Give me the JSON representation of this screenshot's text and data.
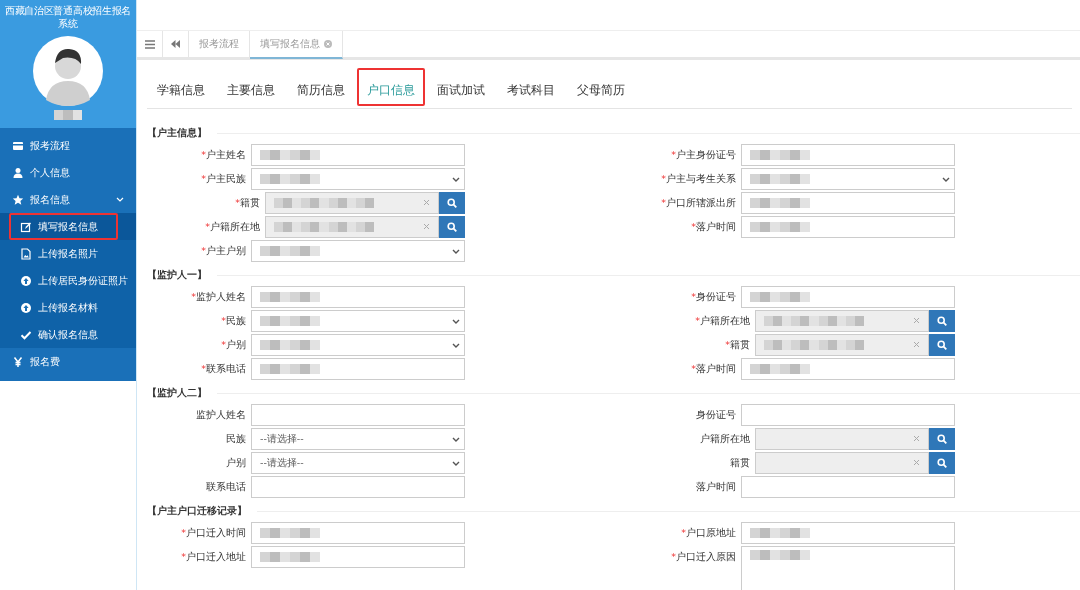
{
  "sidebar": {
    "title": "西藏自治区普通高校招生报名系统",
    "user": {
      "name_redacted": true
    },
    "menu": [
      {
        "label": "报考流程"
      },
      {
        "label": "个人信息"
      },
      {
        "label": "报名信息",
        "expanded": true,
        "children": [
          {
            "label": "填写报名信息",
            "selected": true,
            "highlighted": true
          },
          {
            "label": "上传报名照片",
            "selected": false,
            "highlighted": false
          },
          {
            "label": "上传居民身份证照片",
            "selected": false,
            "highlighted": false
          },
          {
            "label": "上传报名材料",
            "selected": false,
            "highlighted": false
          },
          {
            "label": "确认报名信息",
            "selected": false,
            "highlighted": false
          }
        ]
      },
      {
        "label": "报名费"
      }
    ]
  },
  "page_tabs": [
    {
      "label": "报考流程",
      "selected": false,
      "closable": false
    },
    {
      "label": "填写报名信息",
      "selected": true,
      "closable": true
    }
  ],
  "form_tabs": [
    {
      "label": "学籍信息",
      "selected": false,
      "highlighted": false
    },
    {
      "label": "主要信息",
      "selected": false,
      "highlighted": false
    },
    {
      "label": "简历信息",
      "selected": false,
      "highlighted": false
    },
    {
      "label": "户口信息",
      "selected": true,
      "highlighted": true
    },
    {
      "label": "面试加试",
      "selected": false,
      "highlighted": false
    },
    {
      "label": "考试科目",
      "selected": false,
      "highlighted": false
    },
    {
      "label": "父母简历",
      "selected": false,
      "highlighted": false
    }
  ],
  "sections": [
    {
      "title": "【户主信息】",
      "left": [
        {
          "kind": "text",
          "required_mark": "*",
          "label": "户主姓名",
          "redacted": true
        },
        {
          "kind": "select",
          "required_mark": "*",
          "label": "户主民族",
          "redacted": true
        },
        {
          "kind": "lookup",
          "required_mark": "*",
          "label": "籍贯",
          "redacted": true
        },
        {
          "kind": "lookup",
          "required_mark": "*",
          "label": "户籍所在地",
          "redacted": true
        },
        {
          "kind": "select",
          "required_mark": "*",
          "label": "户主户别",
          "redacted": true
        }
      ],
      "right": [
        {
          "kind": "text",
          "required_mark": "*",
          "label": "户主身份证号",
          "redacted": true
        },
        {
          "kind": "select",
          "required_mark": "*",
          "label": "户主与考生关系",
          "redacted": true
        },
        {
          "kind": "text",
          "required_mark": "*",
          "label": "户口所辖派出所",
          "redacted": true
        },
        {
          "kind": "text",
          "required_mark": "*",
          "label": "落户时间",
          "redacted": true
        }
      ]
    },
    {
      "title": "【监护人一】",
      "left": [
        {
          "kind": "text",
          "required_mark": "*",
          "label": "监护人姓名",
          "redacted": true
        },
        {
          "kind": "select",
          "required_mark": "*",
          "label": "民族",
          "redacted": true
        },
        {
          "kind": "select",
          "required_mark": "*",
          "label": "户别",
          "redacted": true
        },
        {
          "kind": "text",
          "required_mark": "*",
          "label": "联系电话",
          "redacted": true
        }
      ],
      "right": [
        {
          "kind": "text",
          "required_mark": "*",
          "label": "身份证号",
          "redacted": true
        },
        {
          "kind": "lookup",
          "required_mark": "*",
          "label": "户籍所在地",
          "redacted": true
        },
        {
          "kind": "lookup",
          "required_mark": "*",
          "label": "籍贯",
          "redacted": true
        },
        {
          "kind": "text",
          "required_mark": "*",
          "label": "落户时间",
          "redacted": true
        }
      ]
    },
    {
      "title": "【监护人二】",
      "left": [
        {
          "kind": "text",
          "label": "监护人姓名",
          "redacted": false
        },
        {
          "kind": "select",
          "label": "民族",
          "redacted": false,
          "value": "--请选择--"
        },
        {
          "kind": "select",
          "label": "户别",
          "redacted": false,
          "value": "--请选择--"
        },
        {
          "kind": "text",
          "label": "联系电话",
          "redacted": false
        }
      ],
      "right": [
        {
          "kind": "text",
          "label": "身份证号",
          "redacted": false
        },
        {
          "kind": "lookup",
          "label": "户籍所在地",
          "redacted": false
        },
        {
          "kind": "lookup",
          "label": "籍贯",
          "redacted": false
        },
        {
          "kind": "text",
          "label": "落户时间",
          "redacted": false
        }
      ]
    },
    {
      "title": "【户主户口迁移记录】",
      "left": [
        {
          "kind": "text",
          "required_mark": "*",
          "label": "户口迁入时间",
          "redacted": true
        },
        {
          "kind": "text",
          "required_mark": "*",
          "label": "户口迁入地址",
          "redacted": true
        }
      ],
      "right": [
        {
          "kind": "text",
          "required_mark": "*",
          "label": "户口原地址",
          "redacted": true
        },
        {
          "kind": "textarea",
          "required_mark": "*",
          "label": "户口迁入原因",
          "redacted": true
        }
      ]
    }
  ]
}
